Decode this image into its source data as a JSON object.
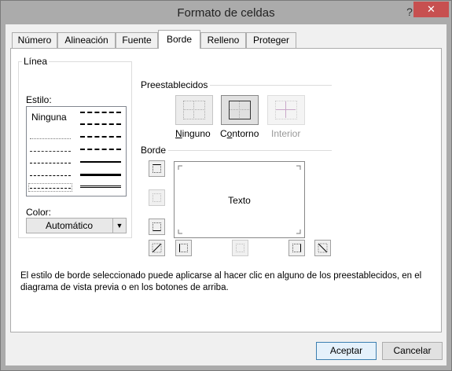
{
  "window": {
    "title": "Formato de celdas",
    "help_label": "?",
    "close_label": "✕"
  },
  "tabs": [
    {
      "label": "Número"
    },
    {
      "label": "Alineación"
    },
    {
      "label": "Fuente"
    },
    {
      "label": "Borde",
      "active": true
    },
    {
      "label": "Relleno"
    },
    {
      "label": "Proteger"
    }
  ],
  "linea": {
    "title": "Línea",
    "estilo_label": "Estilo:",
    "none_label": "Ninguna",
    "color_label": "Color:",
    "color_value": "Automático"
  },
  "presets": {
    "title": "Preestablecidos",
    "items": [
      {
        "label": "Ninguno",
        "accel": "N"
      },
      {
        "label": "Contorno",
        "accel": "o"
      },
      {
        "label": "Interior",
        "disabled": true
      }
    ]
  },
  "border": {
    "title": "Borde",
    "preview_text": "Texto"
  },
  "description": "El estilo de borde seleccionado puede aplicarse al hacer clic en alguno de los preestablecidos, en el diagrama de vista previa o en los botones de arriba.",
  "buttons": {
    "ok": "Aceptar",
    "cancel": "Cancelar"
  },
  "colors": {
    "close": "#c75050",
    "default_button_border": "#3c7fb1"
  }
}
